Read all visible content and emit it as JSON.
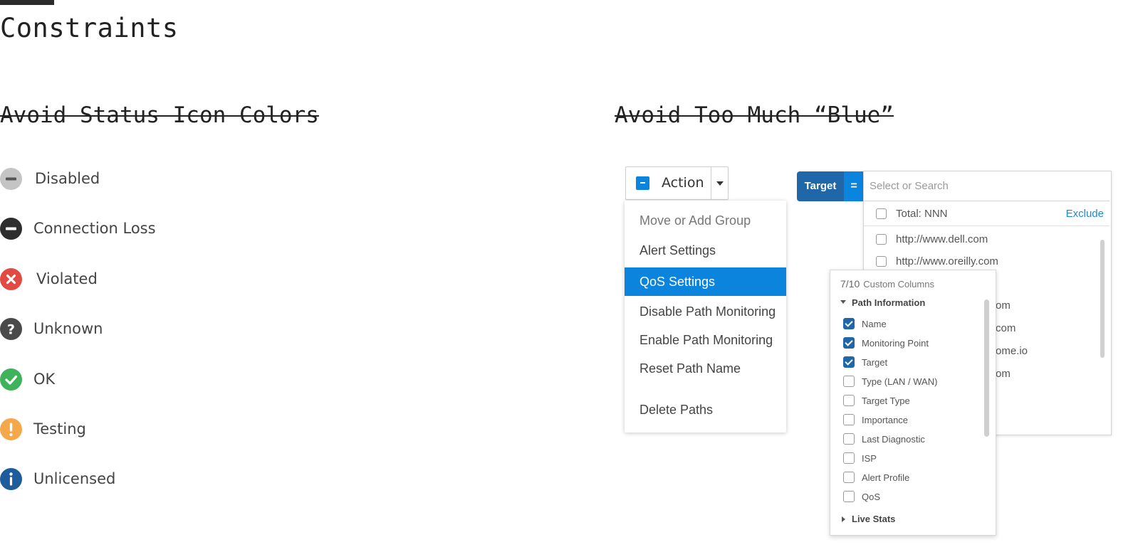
{
  "page": {
    "title": "Constraints"
  },
  "status_section": {
    "title": "Avoid Status Icon Colors",
    "items": [
      {
        "label": "Disabled",
        "icon": "minus-circle-icon",
        "color": "#c4c4c4"
      },
      {
        "label": "Connection Loss",
        "icon": "minus-circle-icon",
        "color": "#2e2e2e"
      },
      {
        "label": "Violated",
        "icon": "x-circle-icon",
        "color": "#e04b43"
      },
      {
        "label": "Unknown",
        "icon": "question-circle-icon",
        "color": "#4a4a4a"
      },
      {
        "label": "OK",
        "icon": "check-circle-icon",
        "color": "#3fb35c"
      },
      {
        "label": "Testing",
        "icon": "exclamation-circle-icon",
        "color": "#f5a84a"
      },
      {
        "label": "Unlicensed",
        "icon": "info-circle-icon",
        "color": "#1f5c9c"
      }
    ]
  },
  "blue_section": {
    "title": "Avoid Too Much “Blue”",
    "action_dropdown": {
      "label": "Action",
      "menu_items": [
        {
          "label": "Move or Add Group",
          "state": "dimmed"
        },
        {
          "label": "Alert Settings",
          "state": "normal"
        },
        {
          "label": "QoS Settings",
          "state": "selected"
        },
        {
          "label": "Disable Path Monitoring",
          "state": "normal"
        },
        {
          "label": "Enable Path Monitoring",
          "state": "normal"
        },
        {
          "label": "Reset Path Name",
          "state": "normal"
        },
        {
          "label": "Delete Paths",
          "state": "normal"
        }
      ]
    },
    "target_filter": {
      "chip_label": "Target",
      "operator": "=",
      "search_placeholder": "Select or Search",
      "total_label": "Total: NNN",
      "exclude_label": "Exclude",
      "visible_items": [
        "http://www.dell.com",
        "http://www.oreilly.com"
      ],
      "partial_items": [
        "om",
        "com",
        "ome.io",
        "om"
      ]
    },
    "custom_columns": {
      "count": "7/10",
      "title": "Custom Columns",
      "group_expanded": "Path Information",
      "columns": [
        {
          "label": "Name",
          "checked": true
        },
        {
          "label": "Monitoring Point",
          "checked": true
        },
        {
          "label": "Target",
          "checked": true
        },
        {
          "label": "Type (LAN / WAN)",
          "checked": false
        },
        {
          "label": "Target Type",
          "checked": false
        },
        {
          "label": "Importance",
          "checked": false
        },
        {
          "label": "Last Diagnostic",
          "checked": false
        },
        {
          "label": "ISP",
          "checked": false
        },
        {
          "label": "Alert Profile",
          "checked": false
        },
        {
          "label": "QoS",
          "checked": false
        }
      ],
      "group_collapsed": "Live Stats"
    }
  },
  "colors": {
    "primary_blue": "#0a84dc",
    "dark_blue": "#1f67a8",
    "link_blue": "#1a8ad4"
  }
}
